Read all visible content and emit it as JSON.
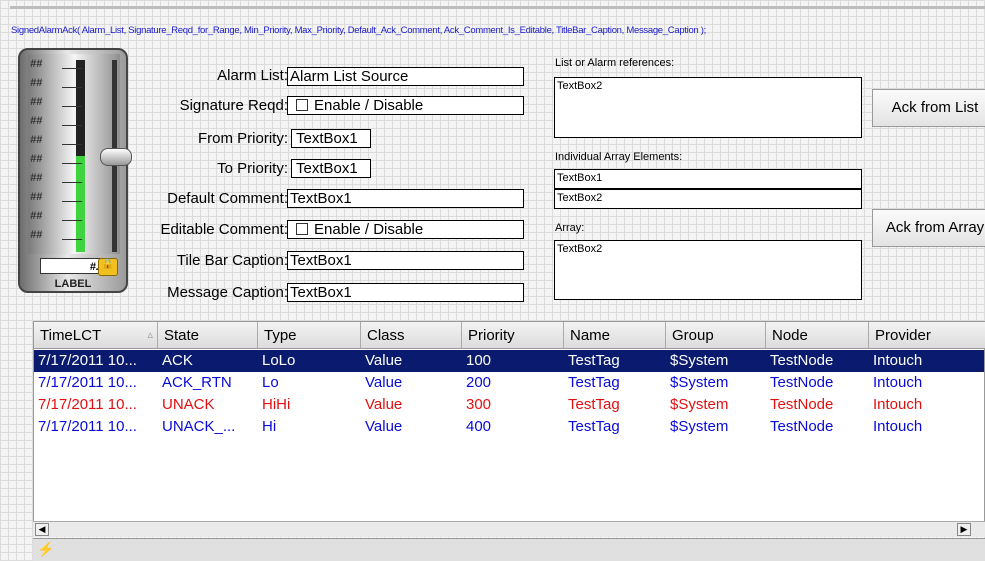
{
  "signature_text": "SignedAlarmAck( Alarm_List, Signature_Reqd_for_Range, Min_Priority, Max_Priority, Default_Ack_Comment, Ack_Comment_Is_Editable, TitleBar_Caption, Message_Caption );",
  "slider": {
    "scale_marks": [
      "##",
      "##",
      "##",
      "##",
      "##",
      "##",
      "##",
      "##",
      "##",
      "##"
    ],
    "readout": "#.#",
    "label": "LABEL",
    "level": 0.5
  },
  "form": {
    "alarm_list_label": "Alarm List:",
    "alarm_list_value": "Alarm List Source",
    "signature_label": "Signature Reqd:",
    "signature_value": "Enable / Disable",
    "from_priority_label": "From Priority:",
    "from_priority_value": "TextBox1",
    "to_priority_label": "To Priority:",
    "to_priority_value": "TextBox1",
    "default_comment_label": "Default Comment:",
    "default_comment_value": "TextBox1",
    "editable_comment_label": "Editable Comment:",
    "editable_comment_value": "Enable / Disable",
    "title_bar_label": "Tile Bar Caption:",
    "title_bar_value": "TextBox1",
    "message_caption_label": "Message Caption:",
    "message_caption_value": "TextBox1"
  },
  "refs": {
    "list_label": "List or Alarm references:",
    "list_value": "TextBox2",
    "individual_label": "Individual Array Elements:",
    "individual_1": "TextBox1",
    "individual_2": "TextBox2",
    "array_label": "Array:",
    "array_value": "TextBox2"
  },
  "buttons": {
    "ack_list": "Ack from List",
    "ack_array": "Ack from Array"
  },
  "grid": {
    "columns": [
      "TimeLCT",
      "State",
      "Type",
      "Class",
      "Priority",
      "Name",
      "Group",
      "Node",
      "Provider"
    ],
    "rows": [
      [
        "7/17/2011 10...",
        "ACK",
        "LoLo",
        "Value",
        "100",
        "TestTag",
        "$System",
        "TestNode",
        "Intouch"
      ],
      [
        "7/17/2011 10...",
        "ACK_RTN",
        "Lo",
        "Value",
        "200",
        "TestTag",
        "$System",
        "TestNode",
        "Intouch"
      ],
      [
        "7/17/2011 10...",
        "UNACK",
        "HiHi",
        "Value",
        "300",
        "TestTag",
        "$System",
        "TestNode",
        "Intouch"
      ],
      [
        "7/17/2011 10...",
        "UNACK_...",
        "Hi",
        "Value",
        "400",
        "TestTag",
        "$System",
        "TestNode",
        "Intouch"
      ]
    ],
    "row_colors": [
      "#ffffff",
      "#0a0ad8",
      "#e01010",
      "#0a0ad8"
    ],
    "selected_row_bg": "#0a1a6e",
    "sort_glyph": "▵"
  },
  "colors": {
    "signature": "#1a1acc",
    "slider_fill": "#3fd43f"
  },
  "icons": {
    "lock": "lock-icon",
    "status": "lightning-icon",
    "scroll_left": "◀",
    "scroll_right": "▶"
  }
}
